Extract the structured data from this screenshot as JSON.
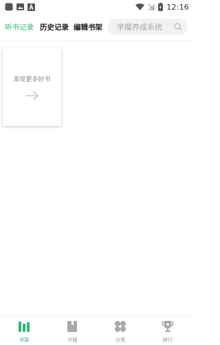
{
  "status_bar": {
    "time": "12:16"
  },
  "header": {
    "tabs": [
      {
        "label": "听书记录",
        "active": true
      },
      {
        "label": "历史记录",
        "active": false
      },
      {
        "label": "编辑书架",
        "active": false
      }
    ],
    "search": {
      "placeholder": "学魔养成系统",
      "icon": "search-icon"
    }
  },
  "shelf": {
    "discover_card": {
      "text": "发现更多好书",
      "icon": "arrow-right-icon"
    }
  },
  "bottom_nav": {
    "items": [
      {
        "label": "书架",
        "icon": "bookshelf-icon",
        "active": true
      },
      {
        "label": "书城",
        "icon": "book-icon",
        "active": false
      },
      {
        "label": "分类",
        "icon": "category-icon",
        "active": false
      },
      {
        "label": "排行",
        "icon": "trophy-icon",
        "active": false
      }
    ]
  },
  "colors": {
    "accent": "#2fb877",
    "text_dark": "#1a1a1a",
    "text_muted": "#9a9a9a",
    "search_bg": "#f2f2f2"
  }
}
